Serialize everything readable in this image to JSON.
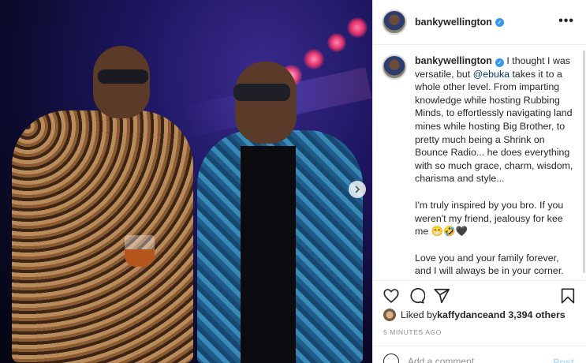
{
  "post": {
    "username": "bankywellington",
    "verified_symbol": "✓",
    "more_symbol": "•••",
    "caption": {
      "intro_before_mention": "I thought I was versatile, but ",
      "mention": "@ebuka",
      "intro_after_mention": " takes it to a whole other level. From imparting knowledge while hosting Rubbing Minds, to effortlessly navigating land mines while hosting Big Brother, to pretty much being a Shrink on Bounce Radio... he does everything with so much grace, charm, wisdom, charisma and style...",
      "para2": "I'm truly inspired by you bro. If you weren't my friend, jealousy for kee me",
      "para2_emojis": "😁🤣🖤",
      "para3": "Love you and your family forever, and I will always be in your corner. God bless you. Now who can guess what I told him to make us laugh like this..."
    },
    "likes": {
      "prefix": "Liked by ",
      "liker": "kaffydance",
      "suffix": " and 3,394 others"
    },
    "time_ago": "5 MINUTES AGO",
    "comment": {
      "placeholder": "Add a comment...",
      "post_label": "Post"
    }
  },
  "colors": {
    "accent": "#3897f0",
    "mention": "#00376b",
    "muted": "#8e8e8e",
    "post_disabled": "#b2dffc"
  },
  "icons": [
    "heart-icon",
    "comment-icon",
    "share-icon",
    "bookmark-icon",
    "emoji-icon",
    "chevron-right-icon",
    "verified-icon",
    "more-icon"
  ]
}
